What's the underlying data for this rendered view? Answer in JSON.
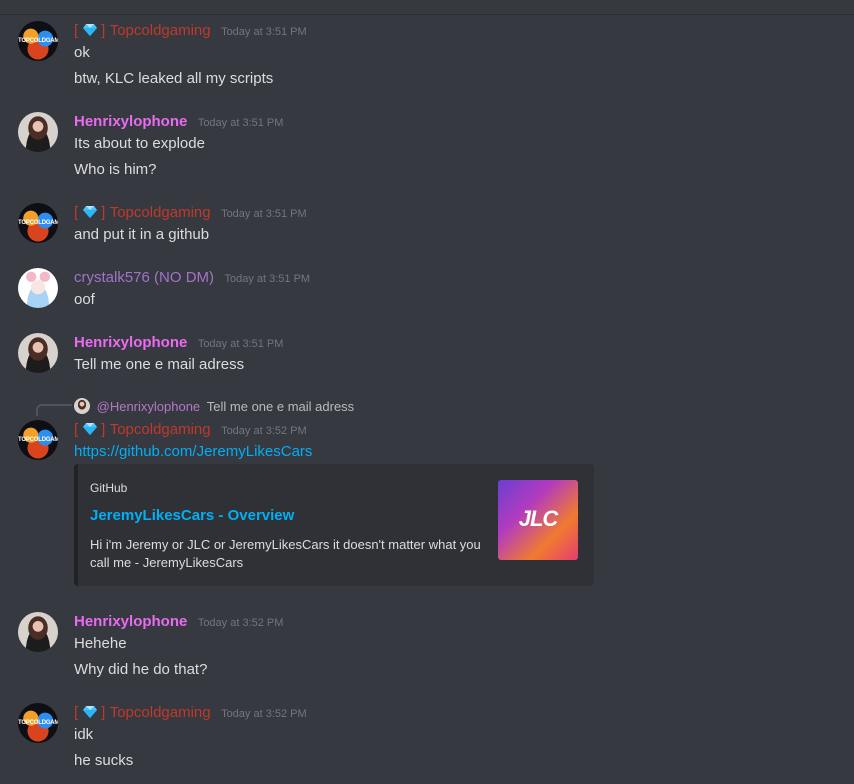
{
  "users": {
    "topcold": {
      "bracket_open": "[",
      "bracket_close": "]",
      "name": "Topcoldgaming",
      "avatar_text": "TOPCOLDGAMING"
    },
    "henrix": {
      "name": "Henrixylophone"
    },
    "crystal": {
      "name": "crystalk576 (NO DM)"
    }
  },
  "messages": [
    {
      "author": "Topcoldgaming",
      "timestamp": "Today at 3:51 PM",
      "lines": [
        "ok",
        "btw, KLC leaked all my scripts"
      ]
    },
    {
      "author": "Henrixylophone",
      "timestamp": "Today at 3:51 PM",
      "lines": [
        "Its about to explode",
        "Who is him?"
      ]
    },
    {
      "author": "Topcoldgaming",
      "timestamp": "Today at 3:51 PM",
      "lines": [
        "and put it in a github"
      ]
    },
    {
      "author": "crystalk576 (NO DM)",
      "timestamp": "Today at 3:51 PM",
      "lines": [
        "oof"
      ]
    },
    {
      "author": "Henrixylophone",
      "timestamp": "Today at 3:51 PM",
      "lines": [
        "Tell me one e mail adress"
      ]
    },
    {
      "author": "Topcoldgaming",
      "timestamp": "Today at 3:52 PM",
      "lines": [
        "https://github.com/JeremyLikesCars"
      ]
    },
    {
      "author": "Henrixylophone",
      "timestamp": "Today at 3:52 PM",
      "lines": [
        "Hehehe",
        "Why did he do that?"
      ]
    },
    {
      "author": "Topcoldgaming",
      "timestamp": "Today at 3:52 PM",
      "lines": [
        "idk",
        "he sucks"
      ]
    }
  ],
  "reply": {
    "mention": "@Henrixylophone",
    "text": "Tell me one e mail adress"
  },
  "embed": {
    "provider": "GitHub",
    "title": "JeremyLikesCars - Overview",
    "description": "Hi i'm Jeremy or JLC or JeremyLikesCars it doesn't matter what you call me - JeremyLikesCars",
    "thumbnail_text": "JLC"
  },
  "colors": {
    "background": "#36393f",
    "topcold_name": "#c0392b",
    "henrix_name": "#e96bf0",
    "crystal_name": "#a372c9",
    "link": "#00aff4",
    "embed_bg": "#2f3136"
  }
}
